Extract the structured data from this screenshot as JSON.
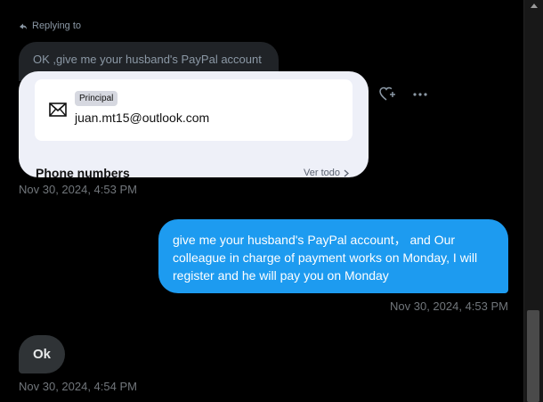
{
  "reply": {
    "label": "Replying to",
    "icon": "reply-arrow-icon"
  },
  "quoted_message": {
    "text": "OK ,give me your husband's PayPal account"
  },
  "contact_card": {
    "badge": "Principal",
    "email": "juan.mt15@outlook.com",
    "phone_section_title": "Phone numbers",
    "see_all": "Ver todo"
  },
  "messages": [
    {
      "direction": "received",
      "timestamp": "Nov 30, 2024, 4:53 PM"
    },
    {
      "direction": "sent",
      "text": "give me your husband's PayPal account， and Our colleague in charge of payment works on Monday, I will register and he will pay you on Monday",
      "timestamp": "Nov 30, 2024, 4:53 PM"
    },
    {
      "direction": "received",
      "text": "Ok",
      "timestamp": "Nov 30, 2024, 4:54 PM"
    }
  ],
  "colors": {
    "background": "#000000",
    "sent_bubble": "#1d9bf0",
    "received_bubble": "#2f3336",
    "timestamp": "#71767b"
  }
}
